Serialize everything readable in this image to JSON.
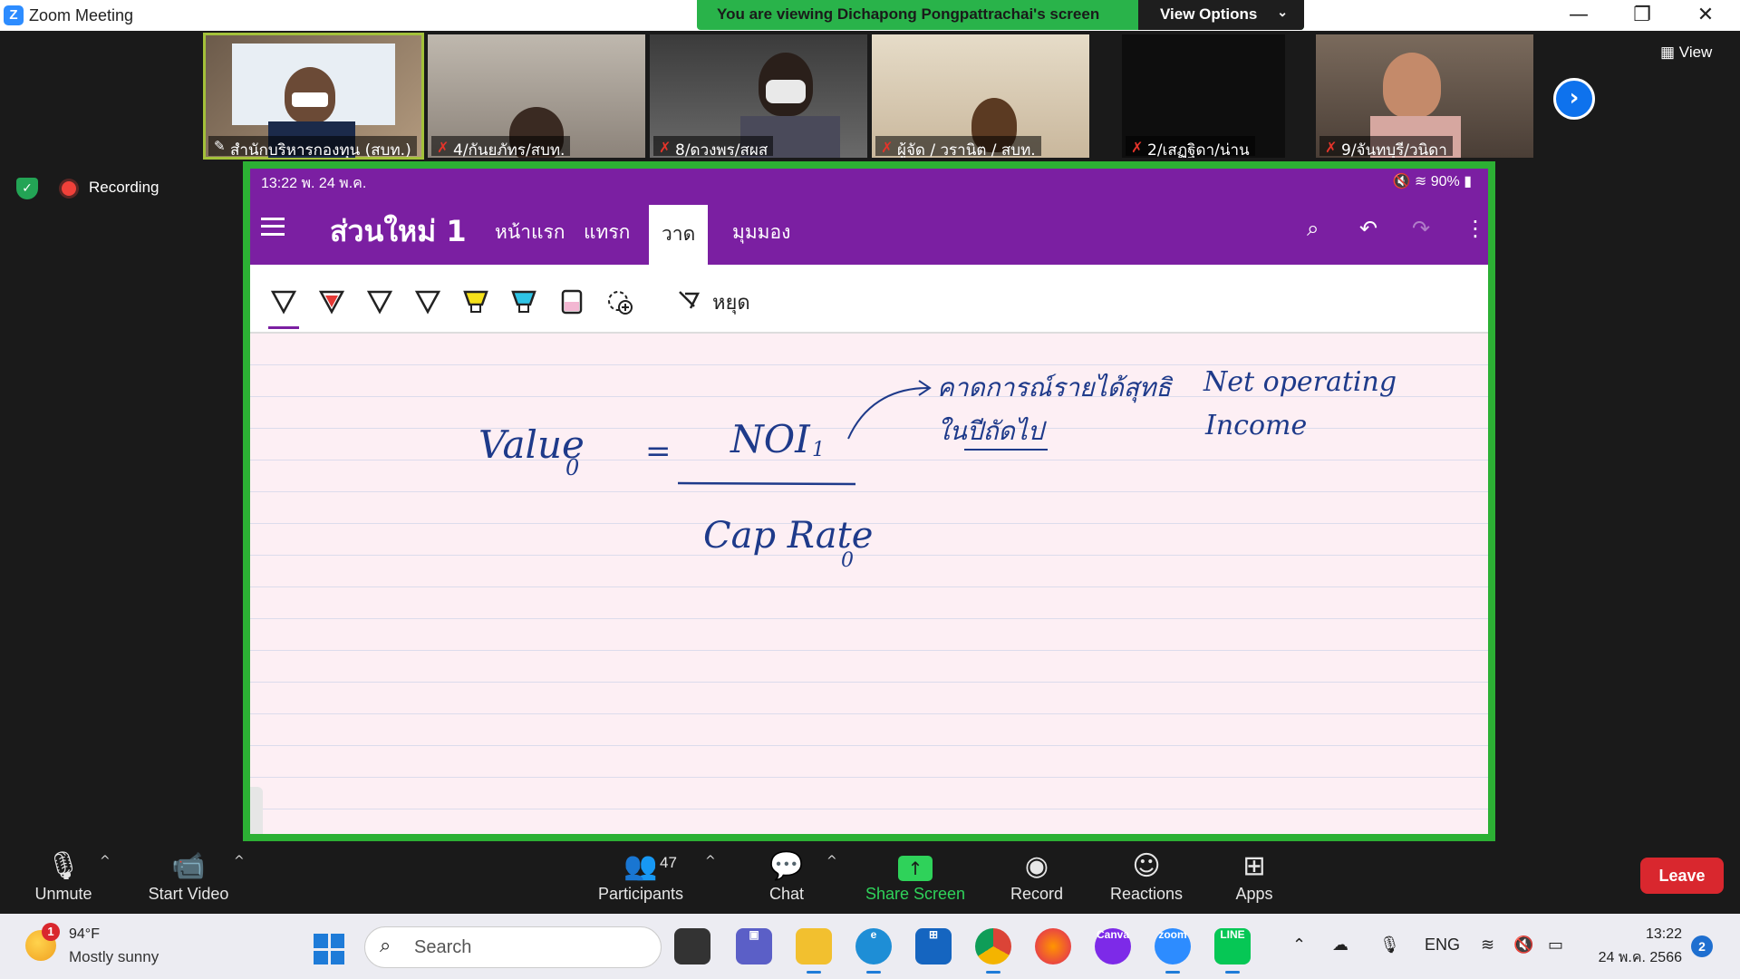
{
  "window": {
    "title": "Zoom Meeting",
    "logo_letter": "Z",
    "minimize": "—",
    "restore": "❐",
    "close": "✕"
  },
  "banner": {
    "text": "You are viewing Dichapong Pongpattrachai's screen",
    "view_options": "View Options"
  },
  "view_button": "View",
  "participants_strip": [
    {
      "name": "สำนักบริหารกองทุน (สบท.)",
      "muted": false
    },
    {
      "name": "4/กันยภัทร/สบท.",
      "muted": true
    },
    {
      "name": "8/ดวงพร/สผส",
      "muted": true
    },
    {
      "name": "ผู้จัด / วรานิต / สบท.",
      "muted": true
    },
    {
      "name": "2/เสฏฐิดา/น่าน",
      "muted": true
    },
    {
      "name": "9/จันทบุรี/วนิดา",
      "muted": true
    }
  ],
  "recording": {
    "label": "Recording"
  },
  "shared_screen": {
    "status_time": "13:22  พ. 24 พ.ค.",
    "status_battery": "90%",
    "page_title": "ส่วนใหม่ 1",
    "tabs": [
      "หน้าแรก",
      "แทรก",
      "วาด",
      "มุมมอง"
    ],
    "selected_tab": "วาด",
    "stop_label": "หยุด",
    "pen_colors": [
      "#ffffff",
      "#e53935",
      "#ffffff",
      "#ffffff",
      "#f5e11a",
      "#2ec4e6",
      "#f3b7d2"
    ],
    "handwriting": {
      "value": "Value",
      "value_sub": "0",
      "equals": "=",
      "noi": "NOI",
      "noi_sub": "1",
      "cap_rate": "Cap Rate",
      "cap_sub": "0",
      "thai_note_line1": "คาดการณ์รายได้สุทธิ",
      "thai_note_line2": "ในปีถัดไป",
      "net_operating": "Net operating",
      "income": "Income"
    }
  },
  "zoombar": {
    "unmute": "Unmute",
    "start_video": "Start Video",
    "participants": "Participants",
    "participants_count": "47",
    "chat": "Chat",
    "share_screen": "Share Screen",
    "record": "Record",
    "reactions": "Reactions",
    "apps": "Apps",
    "leave": "Leave"
  },
  "taskbar": {
    "weather_temp": "94°F",
    "weather_desc": "Mostly sunny",
    "weather_badge": "1",
    "search_placeholder": "Search",
    "lang": "ENG",
    "time": "13:22",
    "date": "24 พ.ค. 2566",
    "notifications": "2",
    "app_labels": {
      "canva": "Canva",
      "zoom": "zoom",
      "line": "LINE"
    }
  },
  "colors": {
    "zoom_green": "#2cb034",
    "onenote_purple": "#7b1fa2",
    "leave_red": "#d9272e",
    "zoom_blue": "#0e72ed"
  }
}
